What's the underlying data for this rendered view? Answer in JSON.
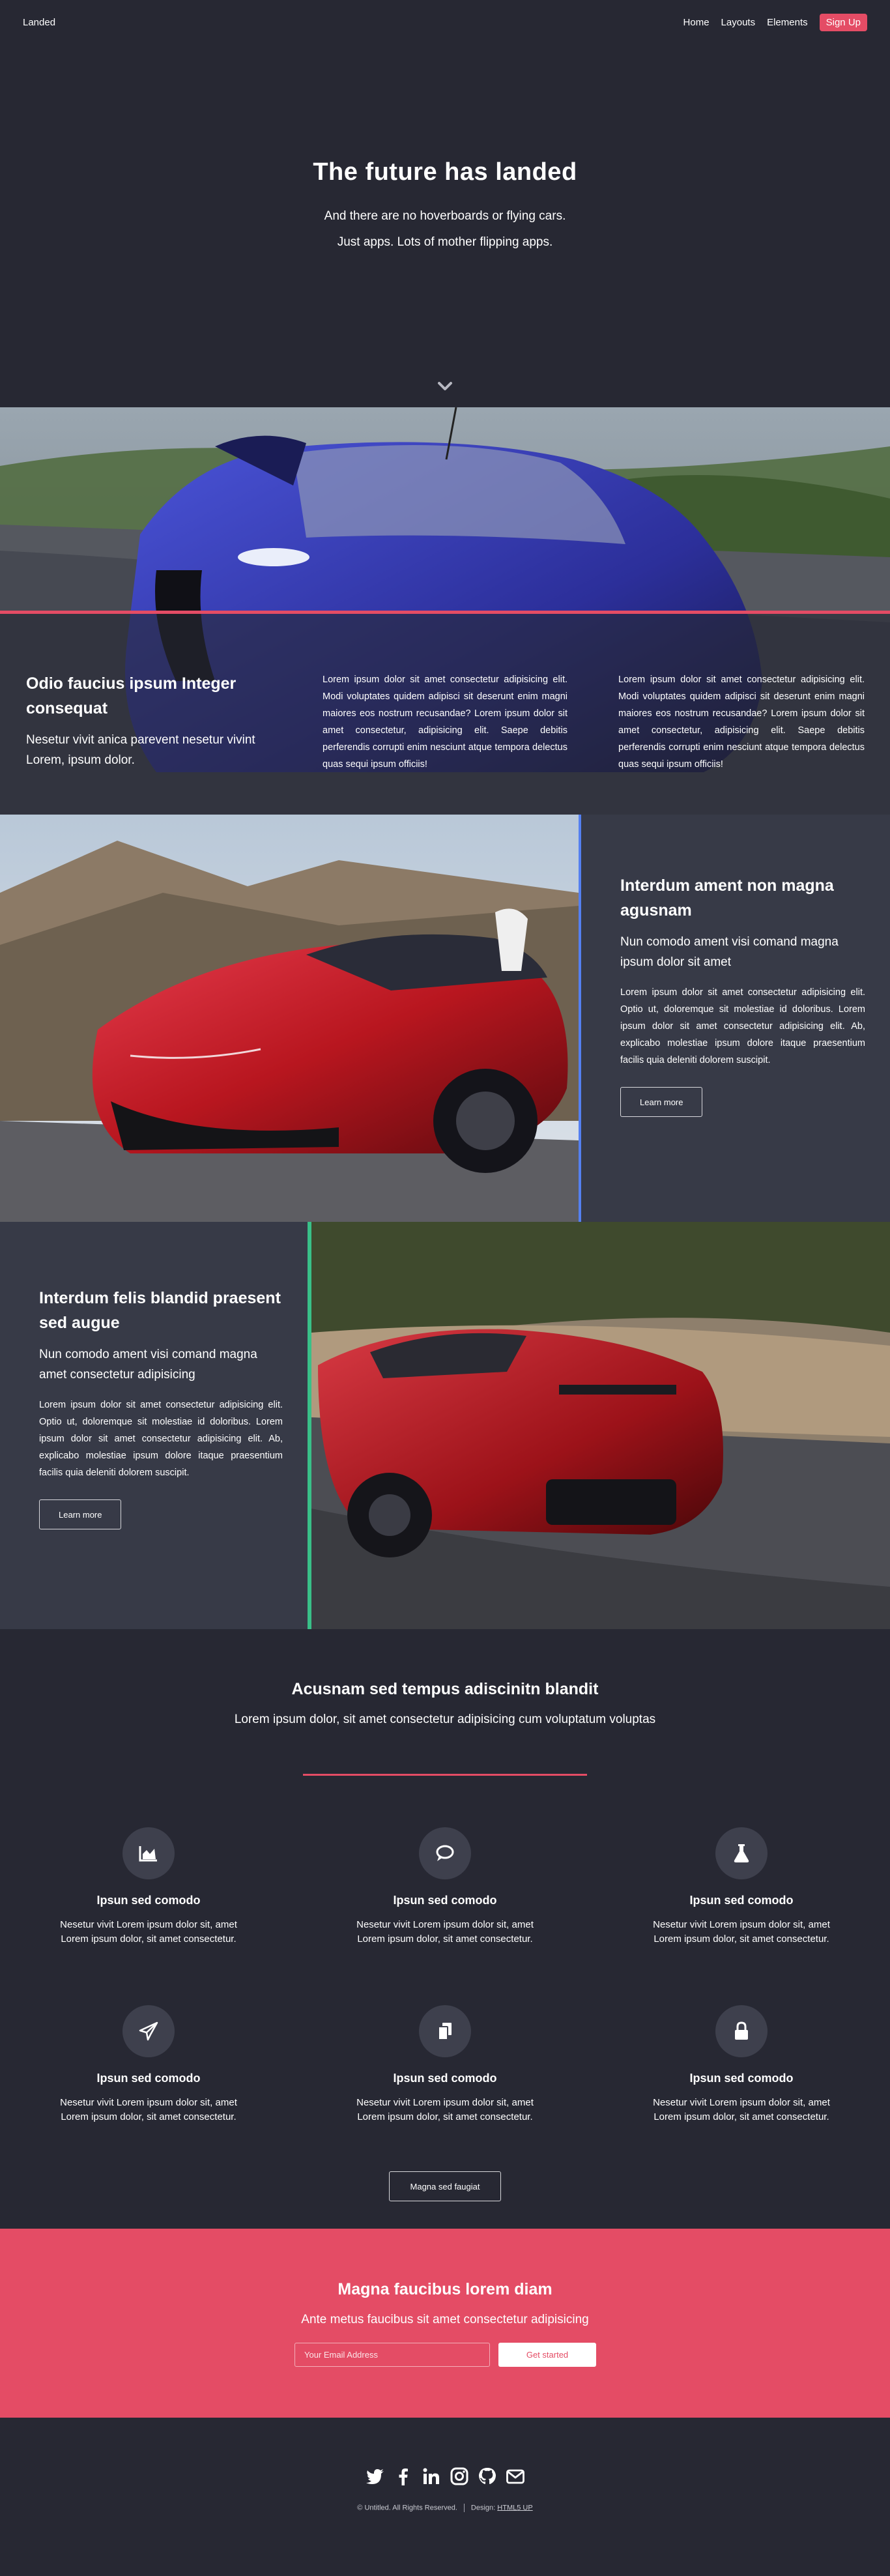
{
  "header": {
    "logo": "Landed",
    "nav": [
      "Home",
      "Layouts",
      "Elements"
    ],
    "signup": "Sign Up"
  },
  "banner": {
    "title": "The future has landed",
    "line1": "And there are no hoverboards or flying cars.",
    "line2": "Just apps. Lots of mother flipping apps."
  },
  "intro": {
    "title": "Odio faucius ipsum Integer consequat",
    "subtitle": "Nesetur vivit anica parevent nesetur vivint Lorem, ipsum dolor.",
    "col2": "Lorem ipsum dolor sit amet consectetur adipisicing elit. Modi voluptates quidem adipisci sit deserunt enim magni maiores eos nostrum recusandae? Lorem ipsum dolor sit amet consectetur, adipisicing elit. Saepe debitis perferendis corrupti enim nesciunt atque tempora delectus quas sequi ipsum officiis!",
    "col3": "Lorem ipsum dolor sit amet consectetur adipisicing elit. Modi voluptates quidem adipisci sit deserunt enim magni maiores eos nostrum recusandae? Lorem ipsum dolor sit amet consectetur, adipisicing elit. Saepe debitis perferendis corrupti enim nesciunt atque tempora delectus quas sequi ipsum officiis!"
  },
  "spotlight1": {
    "title": "Interdum ament non magna agusnam",
    "subtitle": "Nun comodo ament visi comand magna ipsum dolor sit amet",
    "body": "Lorem ipsum dolor sit amet consectetur adipisicing elit. Optio ut, doloremque sit molestiae id doloribus. Lorem ipsum dolor sit amet consectetur adipisicing elit. Ab, explicabo molestiae ipsum dolore itaque praesentium facilis quia deleniti dolorem suscipit.",
    "button": "Learn more",
    "accent": "#5480f1"
  },
  "spotlight2": {
    "title": "Interdum felis blandid praesent sed augue",
    "subtitle": "Nun comodo ament visi comand magna amet consectetur adipisicing",
    "body": "Lorem ipsum dolor sit amet consectetur adipisicing elit. Optio ut, doloremque sit molestiae id doloribus. Lorem ipsum dolor sit amet consectetur adipisicing elit. Ab, explicabo molestiae ipsum dolore itaque praesentium facilis quia deleniti dolorem suscipit.",
    "button": "Learn more",
    "accent": "#39c088"
  },
  "features": {
    "title": "Acusnam sed tempus adiscinitn blandit",
    "subtitle": "Lorem ipsum dolor, sit amet consectetur adipisicing cum voluptatum voluptas",
    "items": [
      {
        "icon": "area-chart-icon",
        "title": "Ipsun sed comodo",
        "text": "Nesetur vivit Lorem ipsum dolor sit, amet Lorem ipsum dolor, sit amet consectetur."
      },
      {
        "icon": "comment-icon",
        "title": "Ipsun sed comodo",
        "text": "Nesetur vivit Lorem ipsum dolor sit, amet Lorem ipsum dolor, sit amet consectetur."
      },
      {
        "icon": "flask-icon",
        "title": "Ipsun sed comodo",
        "text": "Nesetur vivit Lorem ipsum dolor sit, amet Lorem ipsum dolor, sit amet consectetur."
      },
      {
        "icon": "paper-plane-icon",
        "title": "Ipsun sed comodo",
        "text": "Nesetur vivit Lorem ipsum dolor sit, amet Lorem ipsum dolor, sit amet consectetur."
      },
      {
        "icon": "files-icon",
        "title": "Ipsun sed comodo",
        "text": "Nesetur vivit Lorem ipsum dolor sit, amet Lorem ipsum dolor, sit amet consectetur."
      },
      {
        "icon": "lock-icon",
        "title": "Ipsun sed comodo",
        "text": "Nesetur vivit Lorem ipsum dolor sit, amet Lorem ipsum dolor, sit amet consectetur."
      }
    ],
    "button": "Magna sed faugiat"
  },
  "signup": {
    "title": "Magna faucibus lorem diam",
    "subtitle": "Ante metus faucibus sit amet consectetur adipisicing",
    "email_placeholder": "Your Email Address",
    "button": "Get started"
  },
  "footer": {
    "social": [
      "twitter-icon",
      "facebook-icon",
      "linkedin-icon",
      "instagram-icon",
      "github-icon",
      "envelope-icon"
    ],
    "copyright": "© Untitled. All Rights Reserved.",
    "design_label": "Design:",
    "design_link": "HTML5 UP"
  },
  "colors": {
    "background": "#272833",
    "accent": "#e44c65",
    "panel": "#373a47"
  }
}
